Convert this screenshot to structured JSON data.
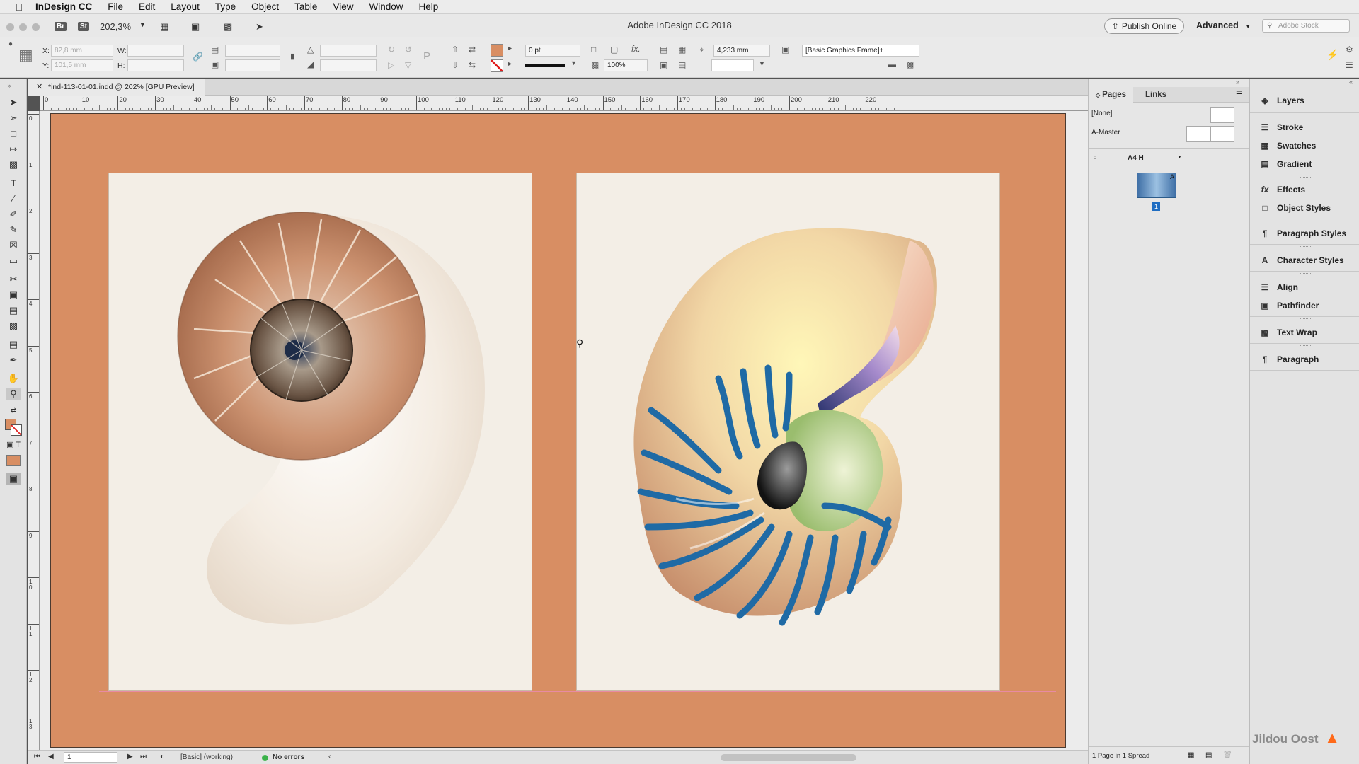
{
  "menubar": {
    "app_name": "InDesign CC",
    "items": [
      "File",
      "Edit",
      "Layout",
      "Type",
      "Object",
      "Table",
      "View",
      "Window",
      "Help"
    ]
  },
  "titlebar": {
    "bridge": "Br",
    "stock": "St",
    "zoom": "202,3%",
    "doc_title": "Adobe InDesign CC 2018",
    "publish_label": "Publish Online",
    "workspace": "Advanced",
    "search_placeholder": "Adobe Stock"
  },
  "control": {
    "x_label": "X:",
    "x_value": "82,8 mm",
    "y_label": "Y:",
    "y_value": "101,5 mm",
    "w_label": "W:",
    "h_label": "H:",
    "fill_color": "#d88e63",
    "stroke_weight": "0 pt",
    "opacity": "100%",
    "offset": "4,233 mm",
    "object_style": "[Basic Graphics Frame]+"
  },
  "document": {
    "tab_label": "*ind-113-01-01.indd @ 202% [GPU Preview]",
    "paper_color": "#d88e63",
    "ruler_marks": [
      "0",
      "10",
      "20",
      "30",
      "40",
      "50",
      "60",
      "70",
      "80",
      "90",
      "100",
      "110",
      "120",
      "130",
      "140",
      "150",
      "160",
      "170",
      "180",
      "190",
      "200",
      "210",
      "220"
    ],
    "vruler_marks": [
      "0",
      "1",
      "2",
      "3",
      "4",
      "5",
      "6",
      "7",
      "8",
      "9",
      "1 0",
      "1 1",
      "1 2",
      "1 3"
    ]
  },
  "status": {
    "page": "1",
    "style": "[Basic] (working)",
    "preflight": "No errors"
  },
  "pages_panel": {
    "tab_pages": "Pages",
    "tab_links": "Links",
    "none": "[None]",
    "master": "A-Master",
    "size": "A4 H",
    "page_number": "1",
    "master_letter": "A",
    "footer": "1 Page in 1 Spread"
  },
  "dock": {
    "items": [
      "Layers",
      "Stroke",
      "Swatches",
      "Gradient",
      "Effects",
      "Object Styles",
      "Paragraph Styles",
      "Character Styles",
      "Align",
      "Pathfinder",
      "Text Wrap",
      "Paragraph"
    ]
  },
  "watermark": "Jildou Oost"
}
